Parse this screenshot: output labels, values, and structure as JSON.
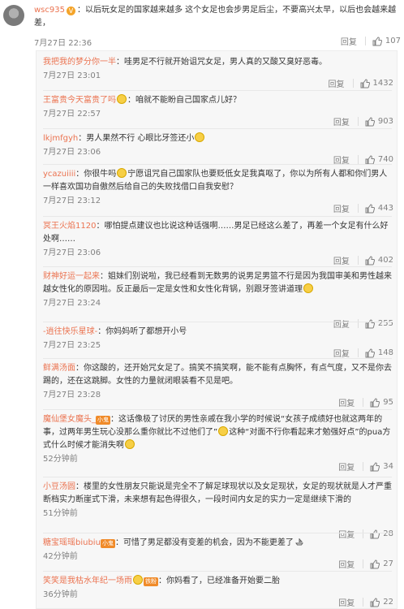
{
  "main_comment": {
    "username": "wsc935",
    "text": "以后玩女足的国家越来越多 这个女足也会步男足后尘，不要高兴太早，以后也会越来越差，",
    "time": "7月27日 22:36",
    "reply": "回复",
    "likes": "107"
  },
  "replies": [
    {
      "name": "我把我的梦分你一半",
      "sep": "：",
      "text": "哇男足不行就开始诅咒女足，男人真的又酸又臭好恶毒。",
      "time": "7月27日 23:01",
      "reply": "回复",
      "likes": "1432"
    },
    {
      "name": "王富贵今天富贵了吗",
      "sep": "：",
      "text": "咱就不能盼自己国家点儿好？",
      "time": "7月27日 22:57",
      "reply": "回复",
      "likes": "903"
    },
    {
      "name": "lkjmfgyh",
      "sep": "：",
      "text": "男人果然不行 心眼比牙签还小",
      "time": "7月27日 23:06",
      "reply": "回复",
      "likes": "740"
    },
    {
      "name": "ycazuiiii",
      "sep": "：",
      "text": "你很牛吗",
      "text2": "宁愿诅咒自己国家队也要贬低女足我真呕了，你以为所有人都和你们男人一样喜欢国功自傲然后给自己的失败找借口自我安慰？",
      "time": "7月27日 23:12",
      "reply": "回复",
      "likes": "443"
    },
    {
      "name": "冥王火焰1120",
      "sep": "：",
      "text": "哪怕提点建议也比说这种话强啊……男足已经这么差了，再差一个女足有什么好处啊……",
      "time": "7月27日 23:06",
      "reply": "回复",
      "likes": "402"
    },
    {
      "name": "财神好运一起来",
      "sep": "：",
      "text": "姐妹们别说啦，我已经看到无数男的说男足男篮不行是因为我国审美和男性越来越女性化的原因啦。反正最后一定是女性和女性化背锅，别跟牙签讲道理",
      "time": "7月27日 23:24",
      "reply": "回复",
      "likes": "255"
    },
    {
      "name": "-逍往快乐星球-",
      "sep": "：",
      "text": "你妈妈听了都想开小号",
      "time": "7月27日 23:25",
      "reply": "回复",
      "likes": "148"
    },
    {
      "name": "鲜满汤面",
      "sep": "：",
      "text": "你这酸的，还开始咒女足了。搞笑不搞笑啊，能不能有点胸怀，有点气度，又不是你去踢的，还在这跳脚。女性的力量就闭眼装看不见是吧。",
      "time": "7月27日 23:28",
      "reply": "回复",
      "likes": "95"
    },
    {
      "name": "魔仙堡女魔头_",
      "badge": "小鬼",
      "sep": "：",
      "text": "这话像极了讨厌的男性亲戚在我小学的时候说“女孩子成绩好也就这两年的事，过两年男生玩心没那么重你就比不过他们了”",
      "text2": "这种“对面不行你看起来才勉强好点”的pua方式什么时候才能消失啊",
      "time": "52分钟前",
      "reply": "回复",
      "likes": "34"
    },
    {
      "name": "小豆汤圆",
      "sep": "：",
      "text": "楼里的女性朋友只能说是完全不了解足球现状以及女足现状，女足的现状就是人才严重断档实力断崖式下滑，未来想有起色得很久，一段时间内女足的实力一定是继续下滑的",
      "time": "51分钟前",
      "reply": "回复",
      "likes": "28"
    },
    {
      "name": "糖宝瑶瑶biubiu",
      "badge": "小鬼",
      "sep": "：",
      "text": "可惜了男足都没有变差的机会，因为不能更差了",
      "time": "42分钟前",
      "reply": "回复",
      "likes": "27"
    },
    {
      "name": "笑笑是我枯水年纪一场雨",
      "badge": "铁粉",
      "sep": "：",
      "text": "你妈看了，已经准备开始要二胎",
      "time": "36分钟前",
      "reply": "回复",
      "likes": "22"
    }
  ]
}
